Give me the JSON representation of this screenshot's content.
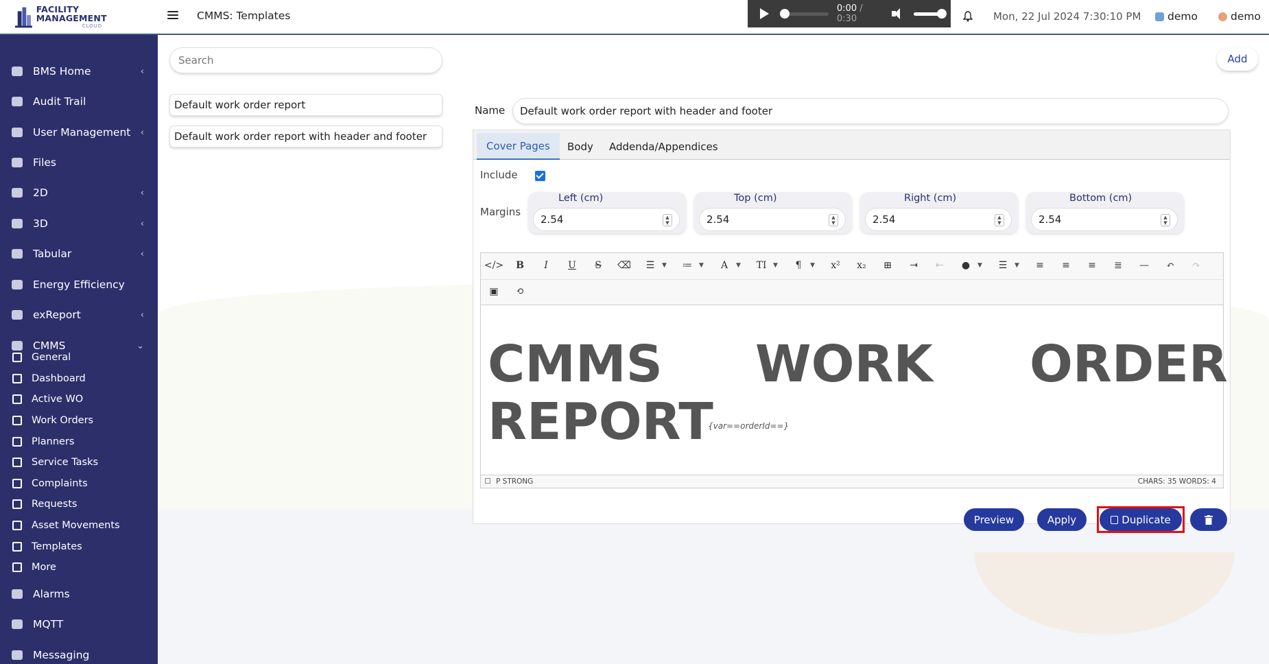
{
  "app": {
    "logo_title": "FACILITY MANAGEMENT",
    "logo_sub": "CLOUD",
    "page_title": "CMMS: Templates"
  },
  "audio": {
    "current": "0:00",
    "separator": " / ",
    "duration": "0:30"
  },
  "header": {
    "datetime": "Mon, 22 Jul 2024 7:30:10 PM",
    "user1": "demo",
    "user2": "demo"
  },
  "sidebar": {
    "items": [
      {
        "label": "BMS Home",
        "icon": "home-icon",
        "chevron": "‹"
      },
      {
        "label": "Audit Trail",
        "icon": "clipboard-icon"
      },
      {
        "label": "User Management",
        "icon": "users-icon",
        "chevron": "‹"
      },
      {
        "label": "Files",
        "icon": "files-icon"
      },
      {
        "label": "2D",
        "icon": "layers-icon",
        "chevron": "‹"
      },
      {
        "label": "3D",
        "icon": "cube-icon",
        "chevron": "‹"
      },
      {
        "label": "Tabular",
        "icon": "table-icon",
        "chevron": "‹"
      },
      {
        "label": "Energy Efficiency",
        "icon": "energy-icon"
      },
      {
        "label": "exReport",
        "icon": "report-icon",
        "chevron": "‹"
      },
      {
        "label": "CMMS",
        "icon": "cmms-icon",
        "chevron": "⌄"
      }
    ],
    "cmms_items": [
      {
        "label": "General",
        "icon": "cogs-icon"
      },
      {
        "label": "Dashboard",
        "icon": "dashboard-icon"
      },
      {
        "label": "Active WO",
        "icon": "wrench-icon"
      },
      {
        "label": "Work Orders",
        "icon": "list-icon"
      },
      {
        "label": "Planners",
        "icon": "planner-icon"
      },
      {
        "label": "Service Tasks",
        "icon": "check-icon"
      },
      {
        "label": "Complaints",
        "icon": "complaint-icon"
      },
      {
        "label": "Requests",
        "icon": "book-icon"
      },
      {
        "label": "Asset Movements",
        "icon": "arrows-icon"
      },
      {
        "label": "Templates",
        "icon": "template-icon"
      },
      {
        "label": "More",
        "icon": "dots-icon"
      }
    ],
    "bottom_items": [
      {
        "label": "Alarms",
        "icon": "alarm-icon"
      },
      {
        "label": "MQTT",
        "icon": "mqtt-icon"
      },
      {
        "label": "Messaging",
        "icon": "message-icon"
      }
    ]
  },
  "templates": {
    "search_placeholder": "Search",
    "list": [
      "Default work order report",
      "Default work order report with header and footer"
    ],
    "add_label": "Add"
  },
  "form": {
    "name_label": "Name",
    "name_value": "Default work order report with header and footer",
    "tabs": [
      "Cover Pages",
      "Body",
      "Addenda/Appendices"
    ],
    "include_label": "Include",
    "include_checked": true,
    "margins_label": "Margins",
    "margins": [
      {
        "label": "Left (cm)",
        "value": "2.54"
      },
      {
        "label": "Top (cm)",
        "value": "2.54"
      },
      {
        "label": "Right (cm)",
        "value": "2.54"
      },
      {
        "label": "Bottom (cm)",
        "value": "2.54"
      }
    ]
  },
  "editor": {
    "words": [
      "CMMS",
      "WORK",
      "ORDER",
      "REPORT"
    ],
    "variable": "{var==orderId==}",
    "status_path": "P   STRONG",
    "status_counts": "CHARS: 35   WORDS: 4"
  },
  "actions": {
    "preview": "Preview",
    "apply": "Apply",
    "duplicate": "Duplicate",
    "delete_icon": "trash-icon"
  },
  "colors": {
    "sidebar_bg": "#2d2f6b",
    "primary_button": "#26399e",
    "highlight": "#e01010"
  }
}
